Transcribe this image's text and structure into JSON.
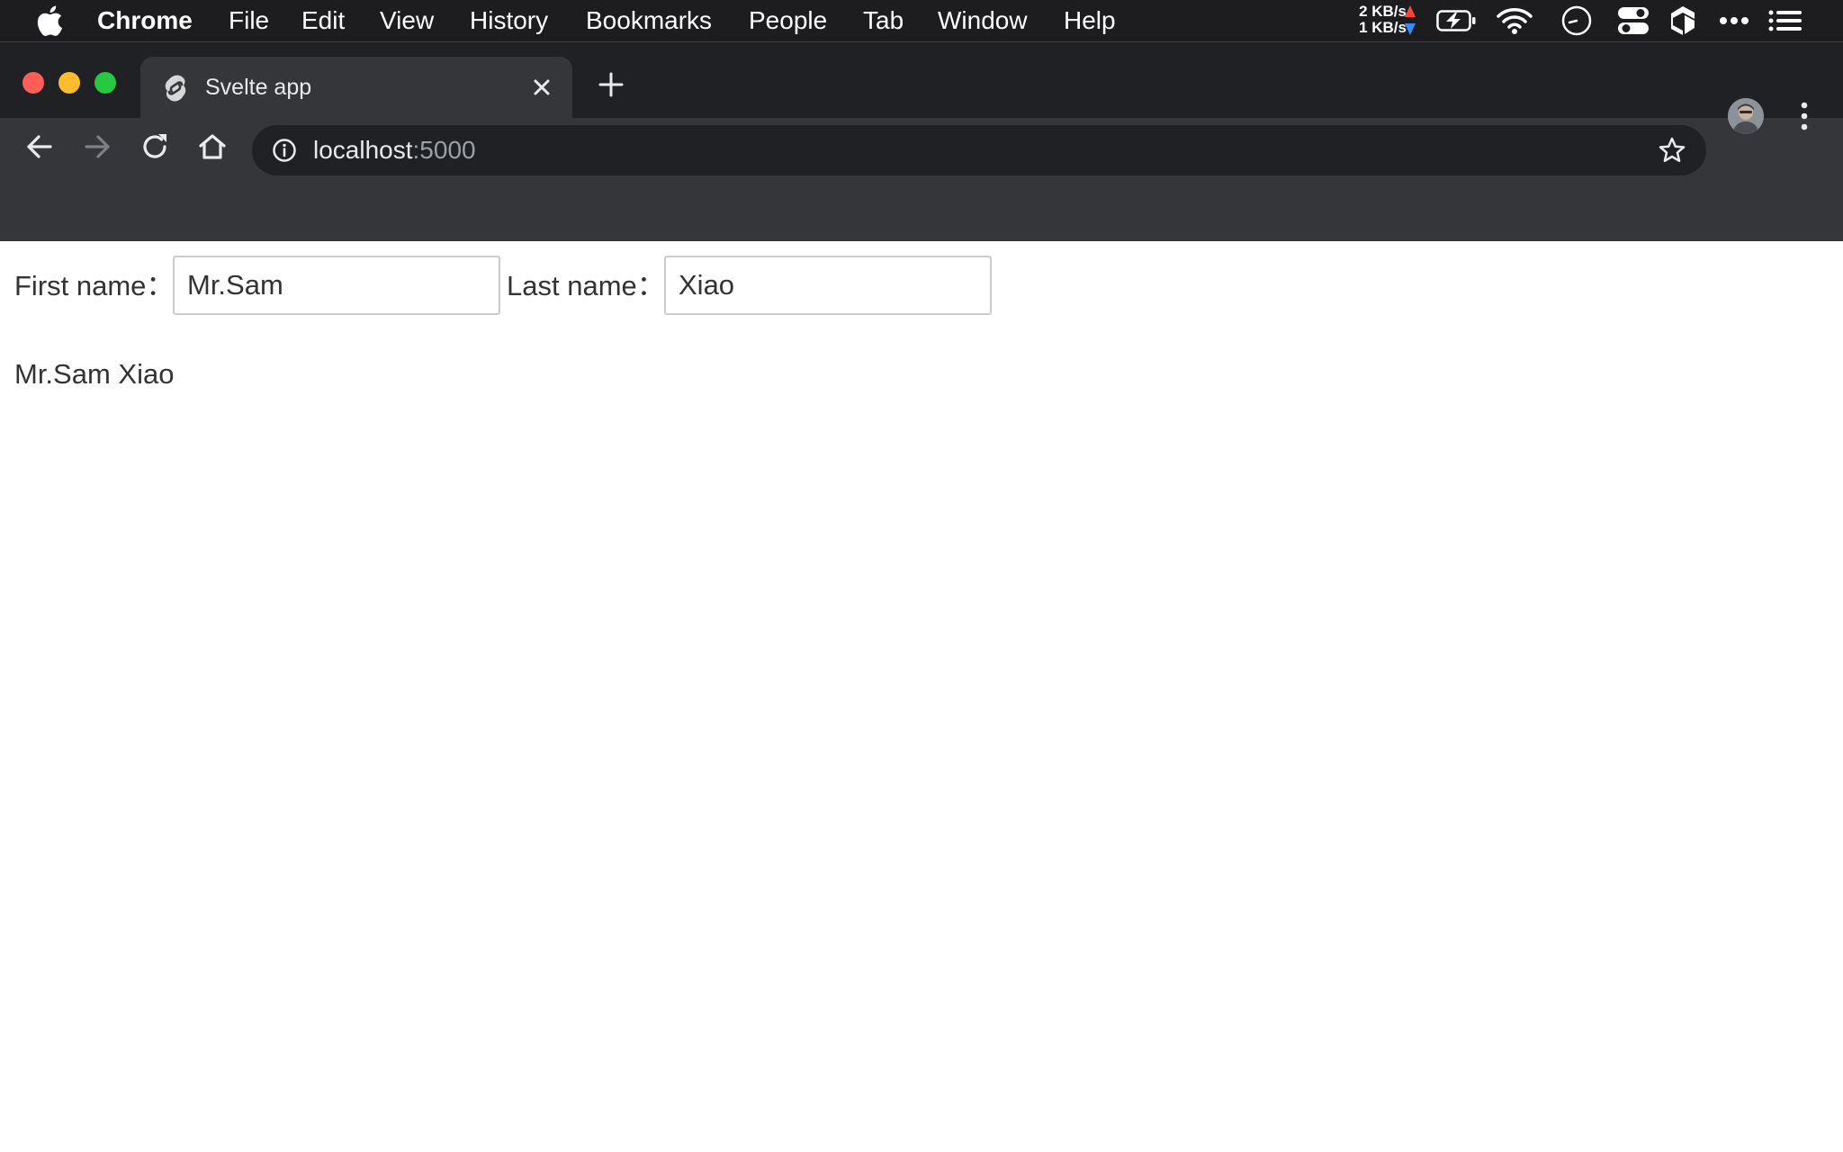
{
  "menubar": {
    "app_name": "Chrome",
    "items": [
      "File",
      "Edit",
      "View",
      "History",
      "Bookmarks",
      "People",
      "Tab",
      "Window",
      "Help"
    ],
    "net_up": "2 KB/s",
    "net_down": "1 KB/s",
    "icons": [
      "apple-logo",
      "battery-charging-icon",
      "wifi-icon",
      "clock-icon",
      "control-center-icon",
      "cube-icon",
      "more-icon",
      "list-icon"
    ]
  },
  "browser": {
    "tab_title": "Svelte app",
    "url_host": "localhost",
    "url_port": ":5000",
    "icons": [
      "back-icon",
      "forward-icon",
      "reload-icon",
      "home-icon",
      "info-icon",
      "star-icon",
      "profile-avatar",
      "menu-dots-icon"
    ]
  },
  "page": {
    "first_label": "First name：",
    "first_value": "Mr.Sam",
    "last_label": "Last name：",
    "last_value": "Xiao",
    "full_name": "Mr.Sam Xiao"
  },
  "colors": {
    "menubar_bg": "#1d1d1f",
    "tabstrip_bg": "#202124",
    "toolbar_bg": "#35363a",
    "traffic_close": "#ff5f57",
    "traffic_min": "#febc2e",
    "traffic_max": "#28c840",
    "net_up_arrow": "#ff453a",
    "net_down_arrow": "#3a8bff"
  }
}
